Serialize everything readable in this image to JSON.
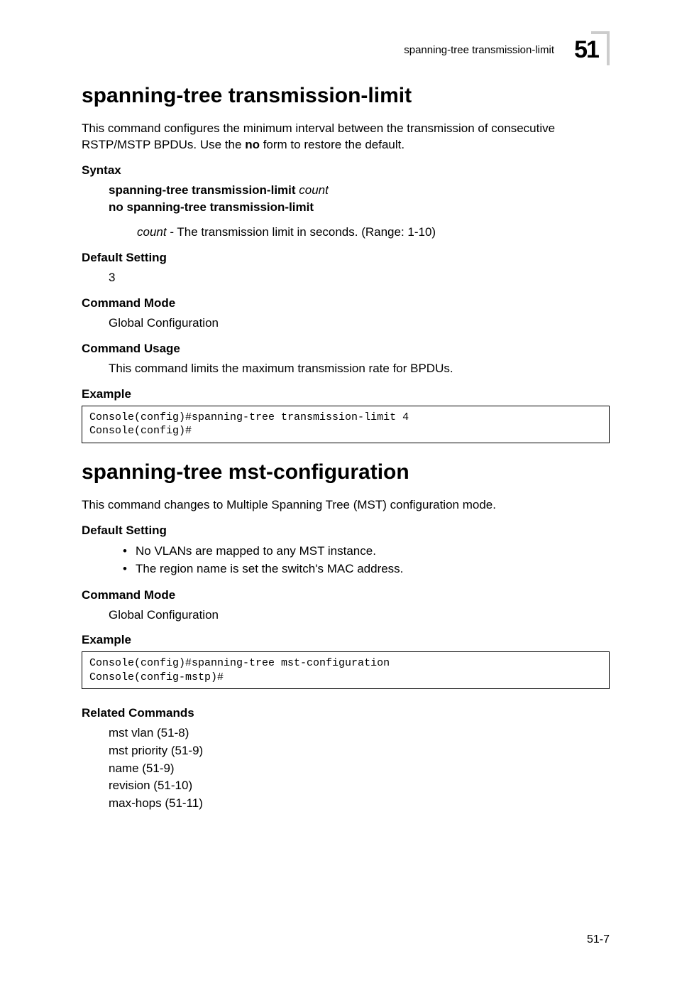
{
  "header": {
    "running_title": "spanning-tree transmission-limit",
    "chapter_number": "51"
  },
  "section1": {
    "title": "spanning-tree transmission-limit",
    "intro_a": "This command configures the minimum interval between the transmission of consecutive RSTP/MSTP BPDUs. Use the ",
    "intro_no": "no",
    "intro_b": " form to restore the default.",
    "syntax_label": "Syntax",
    "syntax_cmd_bold": "spanning-tree transmission-limit",
    "syntax_cmd_italic": " count",
    "syntax_no": "no spanning-tree transmission-limit",
    "param_italic": "count",
    "param_rest": " - The transmission limit in seconds. (Range: 1-10)",
    "default_label": "Default Setting",
    "default_value": "3",
    "cmd_mode_label": "Command Mode",
    "cmd_mode_value": "Global Configuration",
    "usage_label": "Command Usage",
    "usage_value": "This command limits the maximum transmission rate for BPDUs.",
    "example_label": "Example",
    "example_code": "Console(config)#spanning-tree transmission-limit 4\nConsole(config)#"
  },
  "section2": {
    "title": "spanning-tree mst-configuration",
    "intro": "This command changes to Multiple Spanning Tree (MST) configuration mode.",
    "default_label": "Default Setting",
    "bullets": [
      "No VLANs are mapped to any MST instance.",
      "The region name is set the switch's MAC address."
    ],
    "cmd_mode_label": "Command Mode",
    "cmd_mode_value": "Global Configuration",
    "example_label": "Example",
    "example_code": "Console(config)#spanning-tree mst-configuration\nConsole(config-mstp)#",
    "related_label": "Related Commands",
    "related": [
      "mst vlan (51-8)",
      "mst priority (51-9)",
      "name (51-9)",
      "revision (51-10)",
      "max-hops (51-11)"
    ]
  },
  "footer": {
    "page_number": "51-7"
  }
}
